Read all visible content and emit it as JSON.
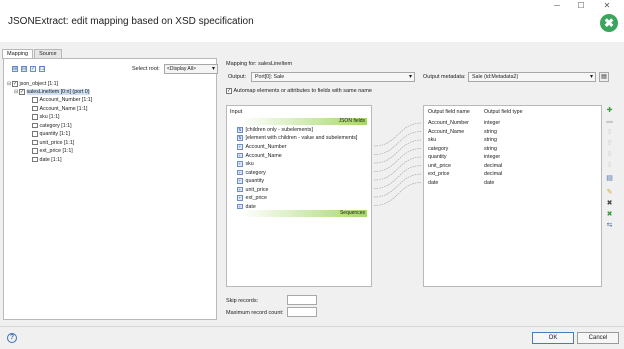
{
  "window": {
    "title": "JSONExtract: edit mapping based on XSD specification",
    "minimize_glyph": "─",
    "maximize_glyph": "☐",
    "close_glyph": "✕",
    "logo_glyph": "✖",
    "logo_color": "#3aa55c"
  },
  "tabs": [
    {
      "label": "Mapping",
      "active": true
    },
    {
      "label": "Source",
      "active": false
    }
  ],
  "tree": {
    "toolbar_glyphs": [
      "⊞",
      "⊟",
      "✓",
      "☐"
    ],
    "select_root_label": "Select root:",
    "select_root_value": "<Display All>",
    "nodes": [
      {
        "label": "json_object [1:1]",
        "checked": true,
        "expander": "⊟"
      },
      {
        "label": "salesLineItem [0:n] (port 0)",
        "checked": true,
        "expander": "⊟"
      },
      {
        "label": "Account_Number [1:1]",
        "checked": false
      },
      {
        "label": "Account_Name [1:1]",
        "checked": false
      },
      {
        "label": "sku [1:1]",
        "checked": false
      },
      {
        "label": "category [1:1]",
        "checked": false
      },
      {
        "label": "quantity [1:1]",
        "checked": false
      },
      {
        "label": "unit_price [1:1]",
        "checked": false
      },
      {
        "label": "ext_price [1:1]",
        "checked": false
      },
      {
        "label": "date [1:1]",
        "checked": false
      }
    ]
  },
  "mapping": {
    "mapping_for": "Mapping for: salesLineItem",
    "output_label": "Output:",
    "output_value": "Port[0]: Sale",
    "output_metadata_label": "Output metadata:",
    "output_metadata_value": "Sale (id:Metadata2)",
    "automap_label": "Automap elements or attributes to fields with same name",
    "automap_checked": true
  },
  "input": {
    "header": "Input",
    "json_fields_label": "JSON fields",
    "sequences_label": "Sequences",
    "special_items": [
      "[children only - subelements]",
      "[element with children - value and subelements]"
    ],
    "fields": [
      "Account_Number",
      "Account_Name",
      "sku",
      "category",
      "quantity",
      "unit_price",
      "ext_price",
      "date"
    ]
  },
  "output": {
    "col_name": "Output field name",
    "col_type": "Output field type",
    "rows": [
      {
        "name": "Account_Number",
        "type": "integer"
      },
      {
        "name": "Account_Name",
        "type": "string"
      },
      {
        "name": "sku",
        "type": "string"
      },
      {
        "name": "category",
        "type": "string"
      },
      {
        "name": "quantity",
        "type": "integer"
      },
      {
        "name": "unit_price",
        "type": "decimal"
      },
      {
        "name": "ext_price",
        "type": "decimal"
      },
      {
        "name": "date",
        "type": "date"
      }
    ]
  },
  "side_tools": [
    "✚",
    "▬",
    "⇧",
    "⇧",
    "⇩",
    "⇩",
    "▤",
    "✎",
    "✖",
    "✖",
    "⇆"
  ],
  "limits": {
    "skip_label": "Skip records:",
    "max_label": "Maximum record count:",
    "skip_value": "",
    "max_value": ""
  },
  "footer": {
    "help_glyph": "?",
    "ok_label": "OK",
    "cancel_label": "Cancel"
  }
}
